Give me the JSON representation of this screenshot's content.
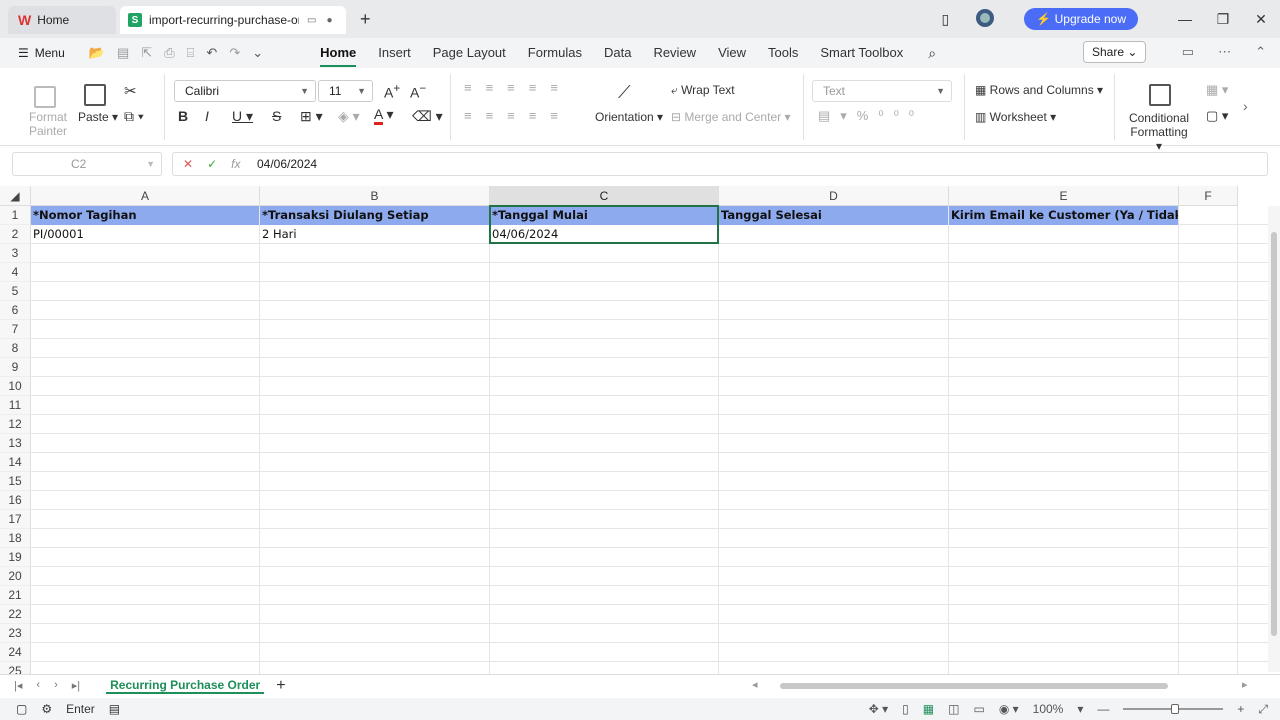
{
  "titlebar": {
    "home_tab": "Home",
    "doc_tab": "import-recurring-purchase-order",
    "upgrade": "Upgrade now"
  },
  "menu": {
    "menu_label": "Menu",
    "tabs": [
      "Home",
      "Insert",
      "Page Layout",
      "Formulas",
      "Data",
      "Review",
      "View",
      "Tools",
      "Smart Toolbox"
    ],
    "active_tab": "Home",
    "share": "Share"
  },
  "ribbon": {
    "format_painter": "Format Painter",
    "paste": "Paste",
    "font_name": "Calibri",
    "font_size": "11",
    "orientation": "Orientation",
    "wrap_text": "Wrap Text",
    "merge_center": "Merge and Center",
    "number_format": "Text",
    "rows_columns": "Rows and Columns",
    "worksheet": "Worksheet",
    "conditional_formatting": "Conditional Formatting"
  },
  "formula_bar": {
    "cell_ref": "C2",
    "value": "04/06/2024"
  },
  "columns": [
    "A",
    "B",
    "C",
    "D",
    "E",
    "F"
  ],
  "selected_column": "C",
  "rows": [
    "1",
    "2",
    "3",
    "4",
    "5",
    "6",
    "7",
    "8",
    "9",
    "10",
    "11",
    "12",
    "13",
    "14",
    "15",
    "16",
    "17",
    "18",
    "19",
    "20",
    "21",
    "22",
    "23",
    "24",
    "25"
  ],
  "sheet": {
    "headers": [
      "*Nomor Tagihan",
      "*Transaksi Diulang Setiap",
      "*Tanggal Mulai",
      "Tanggal Selesai",
      "Kirim Email ke Customer (Ya / Tidak)"
    ],
    "row2": [
      "PI/00001",
      "2 Hari",
      "04/06/2024",
      "",
      ""
    ]
  },
  "sheet_tabs": {
    "active": "Recurring Purchase Order"
  },
  "status": {
    "mode": "Enter",
    "zoom": "100%"
  },
  "colors": {
    "header_fill": "#8eaaee",
    "accent": "#1e8e5a",
    "upgrade": "#4a6cf7"
  }
}
